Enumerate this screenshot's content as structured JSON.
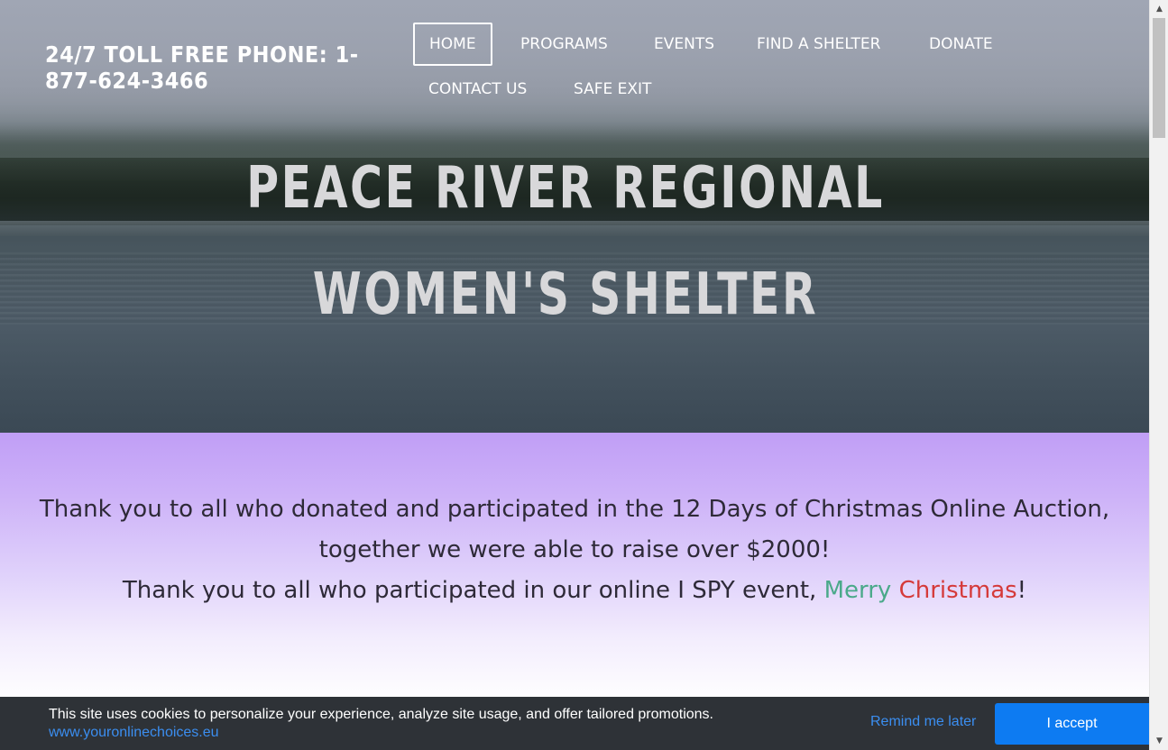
{
  "header": {
    "phone": "24/7 TOLL FREE PHONE: 1-877-624-3466"
  },
  "nav": {
    "items": [
      {
        "label": "HOME",
        "active": true
      },
      {
        "label": "PROGRAMS"
      },
      {
        "label": "EVENTS"
      },
      {
        "label": "FIND A SHELTER"
      },
      {
        "label": "DONATE"
      },
      {
        "label": "CONTACT US"
      },
      {
        "label": "SAFE EXIT"
      }
    ]
  },
  "hero": {
    "title_line1": "PEACE RIVER REGIONAL",
    "title_line2": "WOMEN'S SHELTER"
  },
  "content": {
    "thanks_auction": "Thank you to all who donated and participated in the 12 Days of Christmas Online Auction, together we were able to raise over $2000!",
    "thanks_ispy_prefix": "Thank you to all who participated in our online I SPY event, ",
    "merry": "Merry",
    "christmas": "Christmas",
    "exclaim": "!"
  },
  "cookie": {
    "message": "This site uses cookies to personalize your experience, analyze site usage, and offer tailored promotions.",
    "link": "www.youronlinechoices.eu",
    "remind": "Remind me later",
    "accept": "I accept"
  },
  "colors": {
    "content_gradient_top": "#c09ef6",
    "accept_button": "#0d7bf2",
    "link": "#3b8ef0",
    "merry": "#4aa98a",
    "christmas": "#d53a3a"
  }
}
